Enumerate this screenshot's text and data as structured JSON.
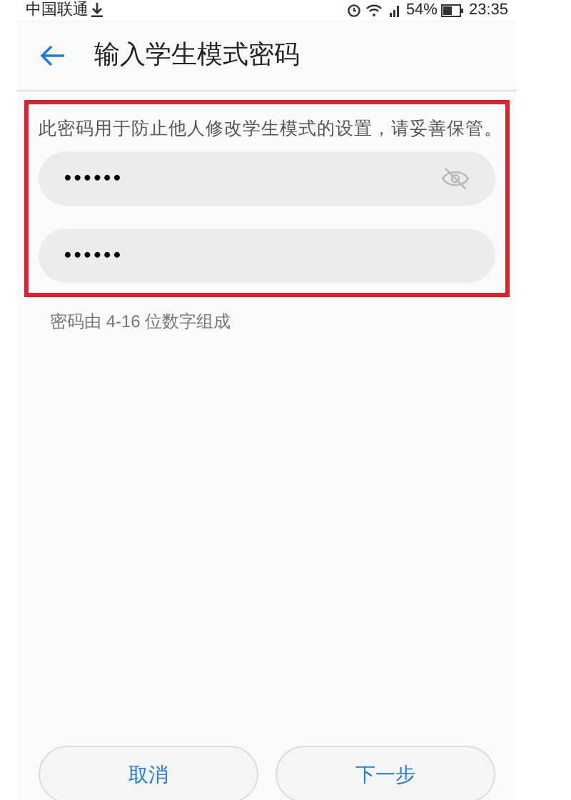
{
  "status_bar": {
    "carrier": "中国联通",
    "battery": "54%",
    "time": "23:35"
  },
  "header": {
    "title": "输入学生模式密码"
  },
  "form": {
    "note": "此密码用于防止他人修改学生模式的设置，请妥善保管。",
    "fields": [
      {
        "value": "••••••",
        "reveal_toggle": true
      },
      {
        "value": "••••••",
        "reveal_toggle": false
      }
    ],
    "hint": "密码由 4-16 位数字组成"
  },
  "buttons": [
    {
      "label": "取消"
    },
    {
      "label": "下一步"
    }
  ]
}
